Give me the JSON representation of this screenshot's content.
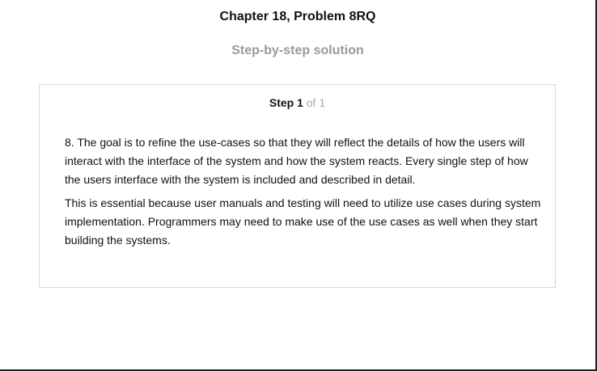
{
  "header": {
    "title": "Chapter 18, Problem 8RQ",
    "subtitle": "Step-by-step solution"
  },
  "step": {
    "label": "Step 1",
    "of": "of 1",
    "paragraphs": [
      "8. The goal is to refine the use-cases so that they will reflect the details of how the users will interact with the interface of the system and how the system reacts. Every single step of how the users interface with the system is included and described in detail.",
      "This is essential because user manuals and testing will need to utilize use cases during system implementation. Programmers may need to make use of the use cases as well when they start building the systems."
    ]
  }
}
